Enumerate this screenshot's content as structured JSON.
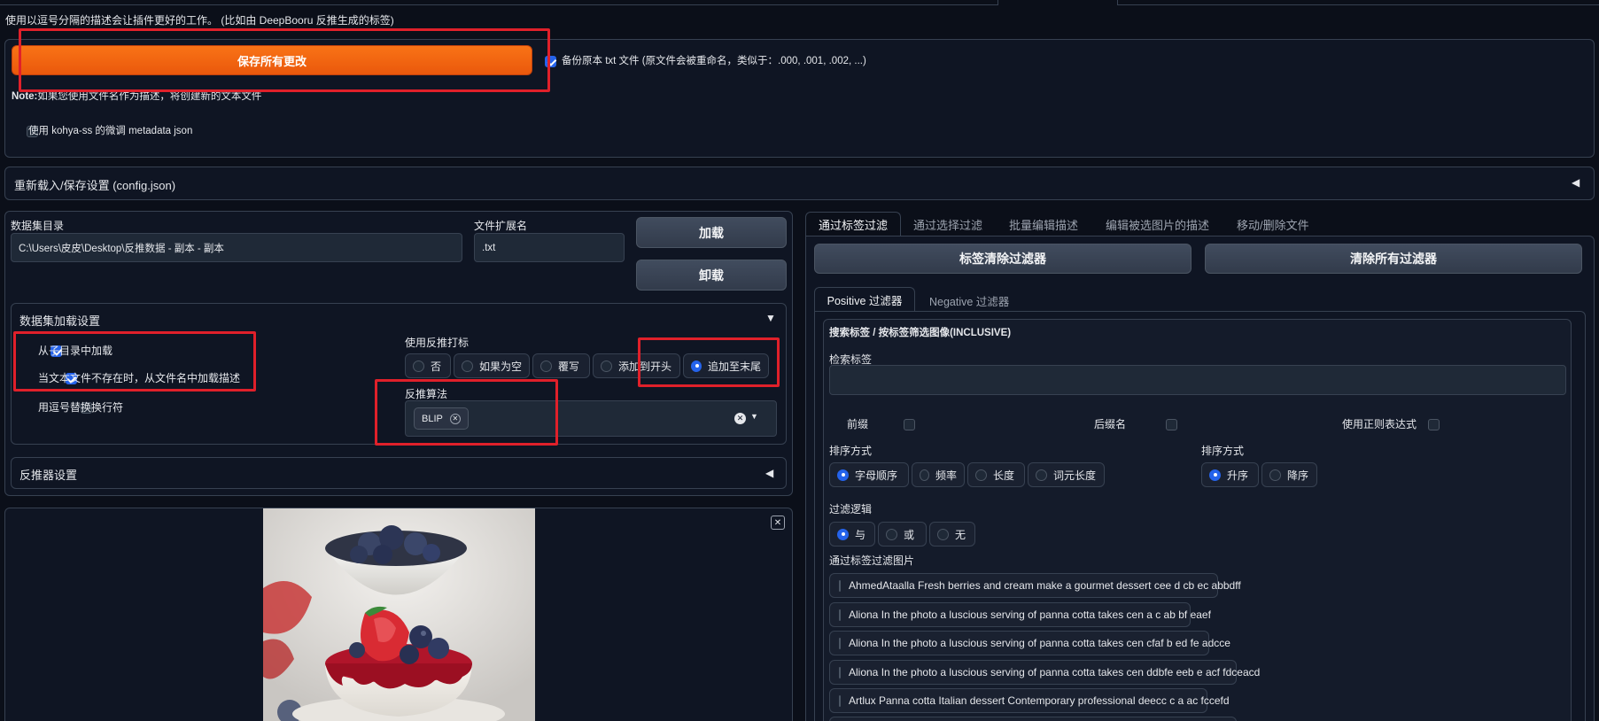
{
  "top_note": "使用以逗号分隔的描述会让插件更好的工作。 (比如由 DeepBooru 反推生成的标签)",
  "save_all_button": "保存所有更改",
  "backup_label": "备份原本 txt 文件 (原文件会被重命名，类似于：.000, .001, .002, ...)",
  "note_prefix": "Note:",
  "note_text": "如果您使用文件名作为描述，将创建新的文本文件",
  "kohya_label": "使用 kohya-ss 的微调 metadata json",
  "reload_section": "重新载入/保存设置 (config.json)",
  "dataset": {
    "dir_label": "数据集目录",
    "dir_value": "C:\\Users\\皮皮\\Desktop\\反推数据 - 副本 - 副本",
    "ext_label": "文件扩展名",
    "ext_value": ".txt",
    "load_button": "加载",
    "unload_button": "卸载"
  },
  "load_settings": {
    "title": "数据集加载设置",
    "load_subdir": "从子目录中加载",
    "load_from_filename": "当文本文件不存在时，从文件名中加载描述",
    "replace_comma": "用逗号替换换行符",
    "interrogate_label": "使用反推打标",
    "interrogate_options": [
      "否",
      "如果为空",
      "覆写",
      "添加到开头",
      "追加至末尾"
    ],
    "algo_label": "反推算法",
    "algo_chip": "BLIP"
  },
  "interrogator_settings": "反推器设置",
  "right_tabs": [
    "通过标签过滤",
    "通过选择过滤",
    "批量编辑描述",
    "编辑被选图片的描述",
    "移动/删除文件"
  ],
  "clear_tag_filter": "标签清除过滤器",
  "clear_all_filters": "清除所有过滤器",
  "filter_tabs": [
    "Positive 过滤器",
    "Negative 过滤器"
  ],
  "filter": {
    "header": "搜索标签 / 按标签筛选图像(INCLUSIVE)",
    "search_label": "检索标签",
    "prefix": "前缀",
    "suffix": "后缀名",
    "regex": "使用正则表达式",
    "sort_label_1": "排序方式",
    "sort_options_1": [
      "字母顺序",
      "频率",
      "长度",
      "词元长度"
    ],
    "sort_label_2": "排序方式",
    "sort_options_2": [
      "升序",
      "降序"
    ],
    "logic_label": "过滤逻辑",
    "logic_options": [
      "与",
      "或",
      "无"
    ],
    "images_label": "通过标签过滤图片",
    "images": [
      "AhmedAtaalla Fresh berries and cream make a gourmet dessert cee d cb ec abbdff",
      "Aliona In the photo a luscious serving of panna cotta takes cen a c ab bf eaef",
      "Aliona In the photo a luscious serving of panna cotta takes cen cfaf b ed fe adcce",
      "Aliona In the photo a luscious serving of panna cotta takes cen ddbfe eeb e acf fdceacd",
      "Artlux Panna cotta Italian dessert Contemporary professional deecc c a ac fccefd"
    ]
  }
}
